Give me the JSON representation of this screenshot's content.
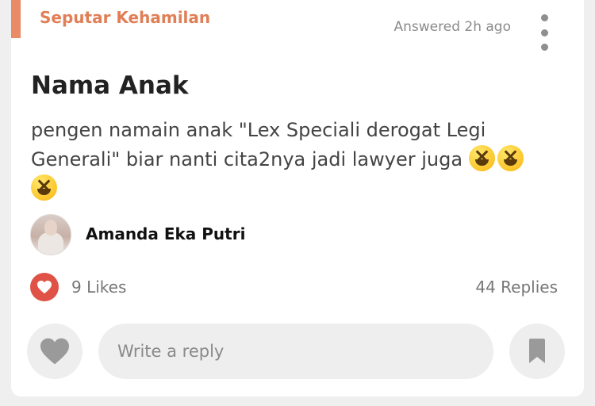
{
  "post": {
    "category": "Seputar Kehamilan",
    "answered": "Answered 2h ago",
    "title": "Nama Anak",
    "body_line1": "pengen namain anak \"Lex Speciali derogat Legi",
    "body_line2": "Generali\" biar nanti cita2nya jadi lawyer juga",
    "emoji": "grinning-squinting-face"
  },
  "author": {
    "name": "Amanda Eka Putri"
  },
  "stats": {
    "likes": "9 Likes",
    "replies": "44 Replies"
  },
  "reply": {
    "placeholder": "Write a reply"
  },
  "colors": {
    "accent": "#e88b66",
    "like_red": "#e05146",
    "icon_gray": "#9a9a9a"
  }
}
